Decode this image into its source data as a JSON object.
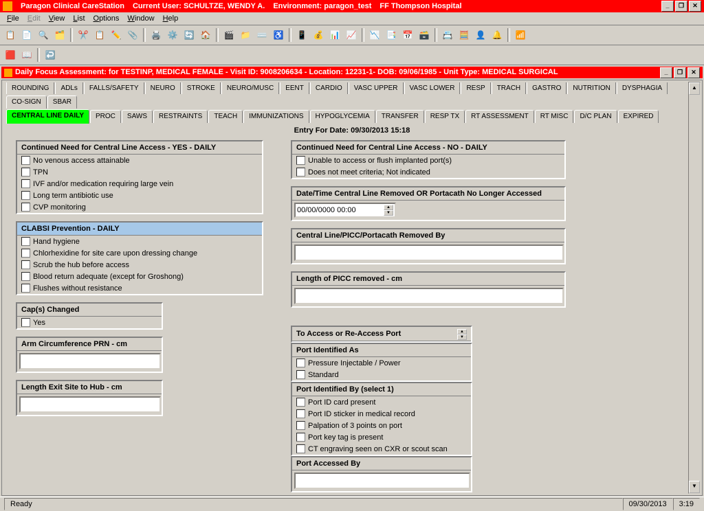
{
  "titlebar": {
    "app": "Paragon Clinical CareStation",
    "user_label": "Current User:",
    "user": "SCHULTZE, WENDY A.",
    "env_label": "Environment:",
    "env": "paragon_test",
    "facility": "FF Thompson Hospital"
  },
  "menu": {
    "file": "File",
    "edit": "Edit",
    "view": "View",
    "list": "List",
    "options": "Options",
    "window": "Window",
    "help": "Help"
  },
  "inner_title": "Daily Focus Assessment:  for TESTINP, MEDICAL FEMALE - Visit ID: 9008206634 - Location: 12231-1- DOB: 09/06/1985 - Unit Type: MEDICAL SURGICAL",
  "tabs_row1": [
    "ROUNDING",
    "ADLs",
    "FALLS/SAFETY",
    "NEURO",
    "STROKE",
    "NEURO/MUSC",
    "EENT",
    "CARDIO",
    "VASC UPPER",
    "VASC LOWER",
    "RESP",
    "TRACH",
    "GASTRO",
    "NUTRITION",
    "DYSPHAGIA"
  ],
  "tabs_row2": [
    "CO-SIGN",
    "SBAR"
  ],
  "tabs_row3": [
    "CENTRAL LINE DAILY",
    "PROC",
    "SAWS",
    "RESTRAINTS",
    "TEACH",
    "IMMUNIZATIONS",
    "HYPOGLYCEMIA",
    "TRANSFER",
    "RESP TX",
    "RT ASSESSMENT",
    "RT MISC",
    "D/C PLAN",
    "EXPIRED"
  ],
  "entry_date": "Entry For Date: 09/30/2013 15:18",
  "groups": {
    "yes_daily": {
      "title": "Continued Need for Central Line Access - YES - DAILY",
      "items": [
        "No venous access attainable",
        "TPN",
        "IVF and/or medication requiring large vein",
        "Long term antibiotic use",
        "CVP monitoring"
      ]
    },
    "clabsi": {
      "title": "CLABSI Prevention - DAILY",
      "items": [
        "Hand hygiene",
        "Chlorhexidine for site care upon dressing change",
        "Scrub the hub before access",
        "Blood return adequate (except for Groshong)",
        "Flushes without resistance"
      ]
    },
    "caps": {
      "title": "Cap(s) Changed",
      "items": [
        "Yes"
      ]
    },
    "arm": {
      "title": "Arm Circumference PRN - cm"
    },
    "exit": {
      "title": "Length Exit Site to Hub - cm"
    },
    "no_daily": {
      "title": "Continued Need for Central Line Access -  NO - DAILY",
      "items": [
        "Unable to access or flush implanted port(s)",
        "Does not meet criteria;  Not indicated"
      ]
    },
    "removed_dt": {
      "title": "Date/Time Central Line Removed OR Portacath No Longer Accessed",
      "value": "00/00/0000 00:00"
    },
    "removed_by": {
      "title": "Central Line/PICC/Portacath Removed By"
    },
    "picc_len": {
      "title": "Length of PICC removed - cm"
    },
    "access_port": {
      "title": "To Access or Re-Access Port"
    },
    "port_id_as": {
      "title": "Port Identified As",
      "items": [
        "Pressure Injectable / Power",
        "Standard"
      ]
    },
    "port_id_by": {
      "title": "Port Identified By (select 1)",
      "items": [
        "Port ID card present",
        "Port ID sticker in medical record",
        "Palpation of 3 points on port",
        "Port key tag is present",
        "CT engraving seen on CXR or scout scan"
      ]
    },
    "port_acc_by": {
      "title": "Port  Accessed By"
    }
  },
  "status": {
    "left": "Ready",
    "date": "09/30/2013",
    "time": "3:19"
  },
  "icons": [
    "📋",
    "📄",
    "🔍",
    "🗂️",
    "✂️",
    "📋",
    "✏️",
    "📎",
    "🖨️",
    "⚙️",
    "🔄",
    "🏠",
    "🎬",
    "📁",
    "⌨️",
    "♿",
    "📱",
    "💰",
    "📊",
    "📈",
    "📉",
    "📑",
    "📅",
    "🗃️",
    "📇",
    "🧮",
    "👤",
    "🔔",
    "📶"
  ]
}
